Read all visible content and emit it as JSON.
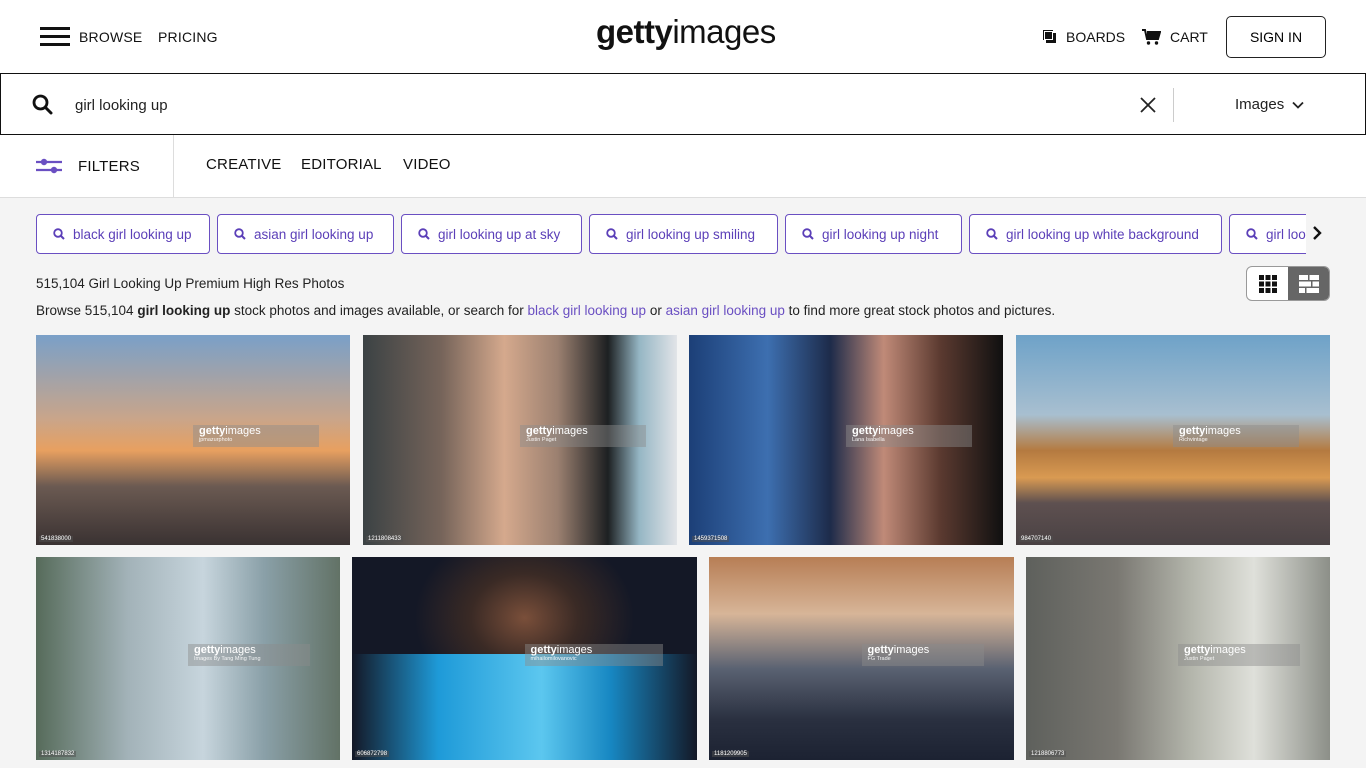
{
  "header": {
    "browse_label": "BROWSE",
    "pricing_label": "PRICING",
    "logo_bold": "getty",
    "logo_light": "images",
    "boards_label": "BOARDS",
    "cart_label": "CART",
    "signin_label": "SIGN IN"
  },
  "search": {
    "value": "girl looking up",
    "media_type": "Images"
  },
  "filterbar": {
    "filters_label": "FILTERS",
    "tabs": [
      "CREATIVE",
      "EDITORIAL",
      "VIDEO"
    ]
  },
  "related_searches": [
    "black girl looking up",
    "asian girl looking up",
    "girl looking up at sky",
    "girl looking up smiling",
    "girl looking up night",
    "girl looking up white background",
    "girl looking up"
  ],
  "results": {
    "title": "515,104 Girl Looking Up Premium High Res Photos",
    "desc_prefix": "Browse 515,104 ",
    "desc_query": "girl looking up",
    "desc_middle": " stock photos and images available, or search for ",
    "desc_link1": "black girl looking up",
    "desc_or": " or ",
    "desc_link2": "asian girl looking up",
    "desc_suffix": " to find more great stock photos and pictures."
  },
  "view_toggle": {
    "options": [
      "grid-view",
      "mosaic-view"
    ],
    "active": "mosaic-view"
  },
  "images": [
    {
      "credit": "jpmazurphoto",
      "id": "541838000"
    },
    {
      "credit": "Justin Paget",
      "id": "1211808433"
    },
    {
      "credit": "Lana Isabella",
      "id": "1459371508"
    },
    {
      "credit": "Richvintage",
      "id": "984707140"
    },
    {
      "credit": "Images By Tang Ming Tung",
      "id": "1314187832"
    },
    {
      "credit": "mihailomilovanovic",
      "id": "606872798"
    },
    {
      "credit": "FG Trade",
      "id": "1181209905"
    },
    {
      "credit": "Justin Paget",
      "id": "1218806773"
    }
  ],
  "colors": {
    "accent": "#6a4fc2",
    "text": "#222222",
    "background": "#f4f4f4"
  }
}
